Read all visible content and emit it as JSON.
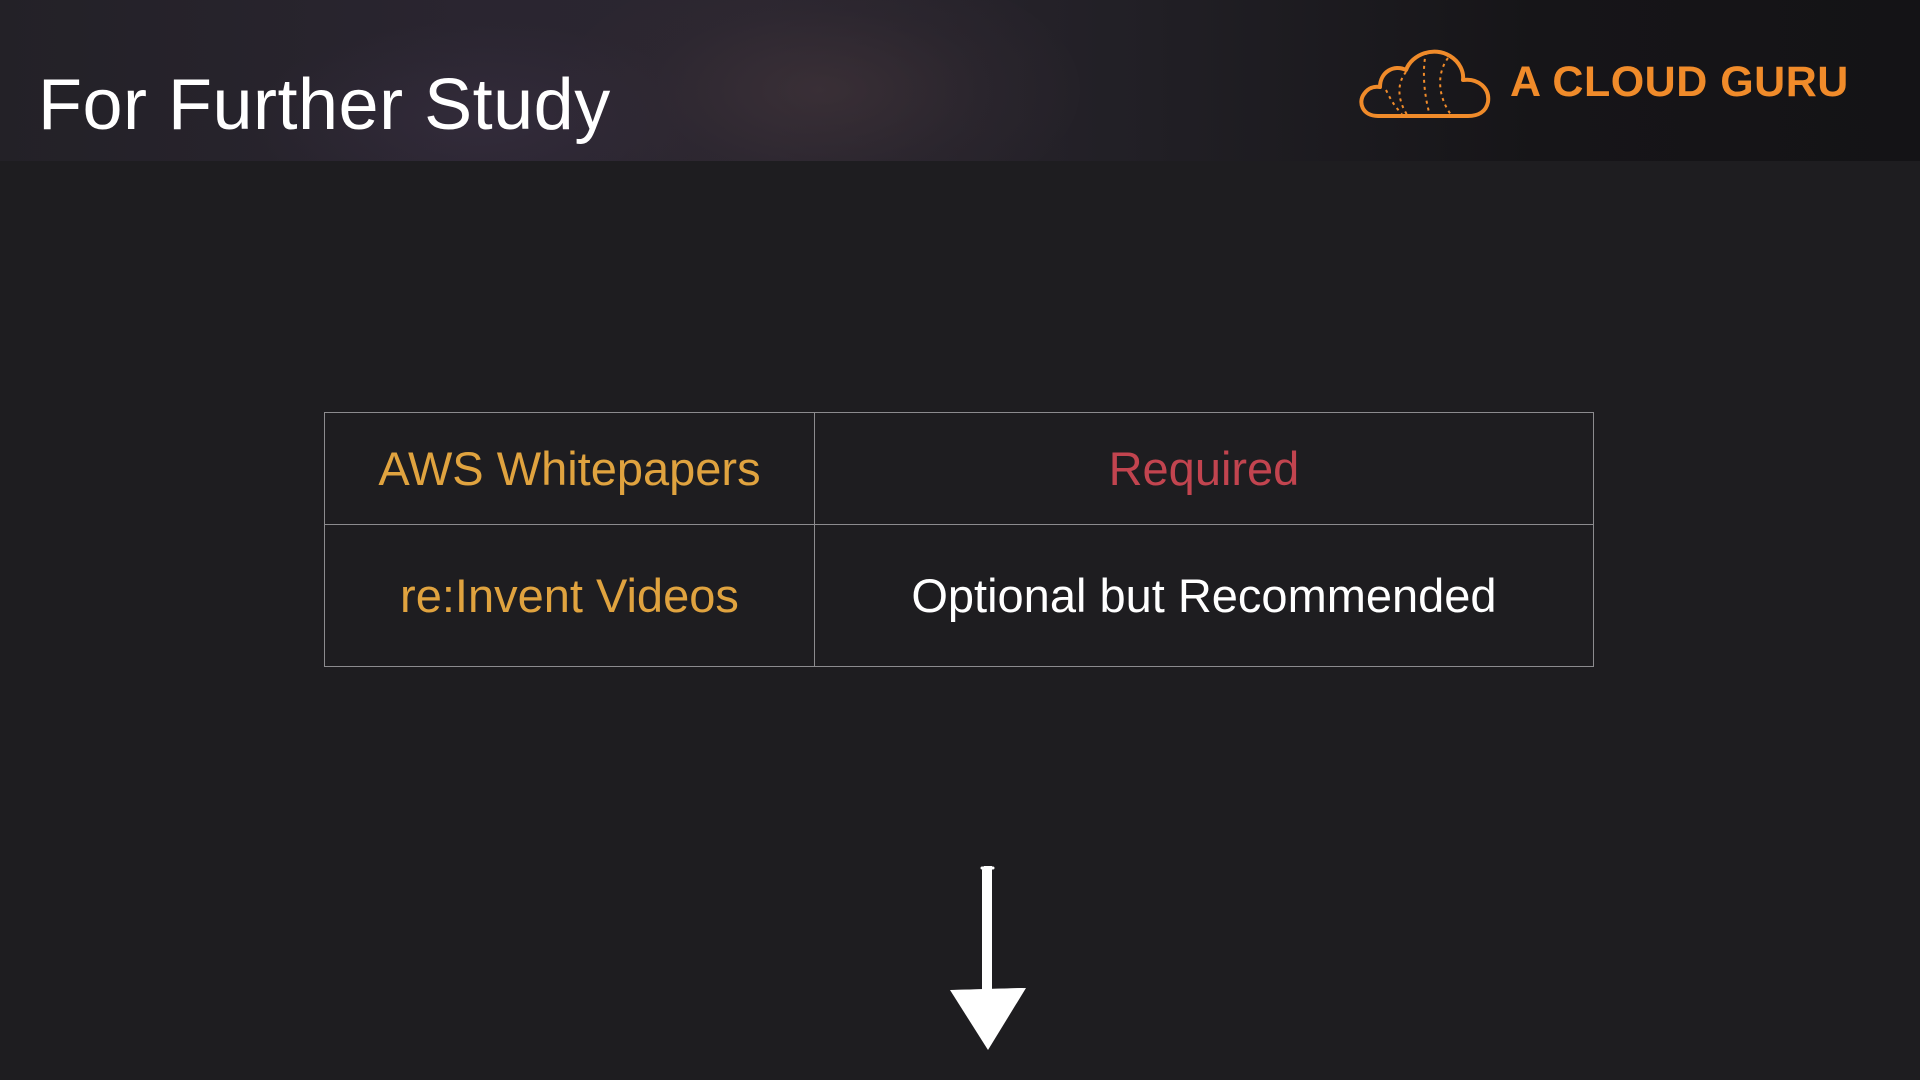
{
  "slide": {
    "title": "For Further Study",
    "brand": {
      "name": "A CLOUD GURU",
      "icon": "cloud-logo-icon",
      "color": "#f08b2a"
    },
    "table": {
      "rows": [
        {
          "resource": "AWS Whitepapers",
          "status": "Required"
        },
        {
          "resource": "re:Invent Videos",
          "status": "Optional but Recommended"
        }
      ]
    },
    "annotation": {
      "icon": "down-arrow-icon",
      "color": "#ffffff"
    },
    "colors": {
      "background": "#1e1d20",
      "title": "#ffffff",
      "resource": "#e0a33f",
      "required": "#c2444f",
      "optional": "#ffffff",
      "border": "#8c8b8e"
    }
  }
}
